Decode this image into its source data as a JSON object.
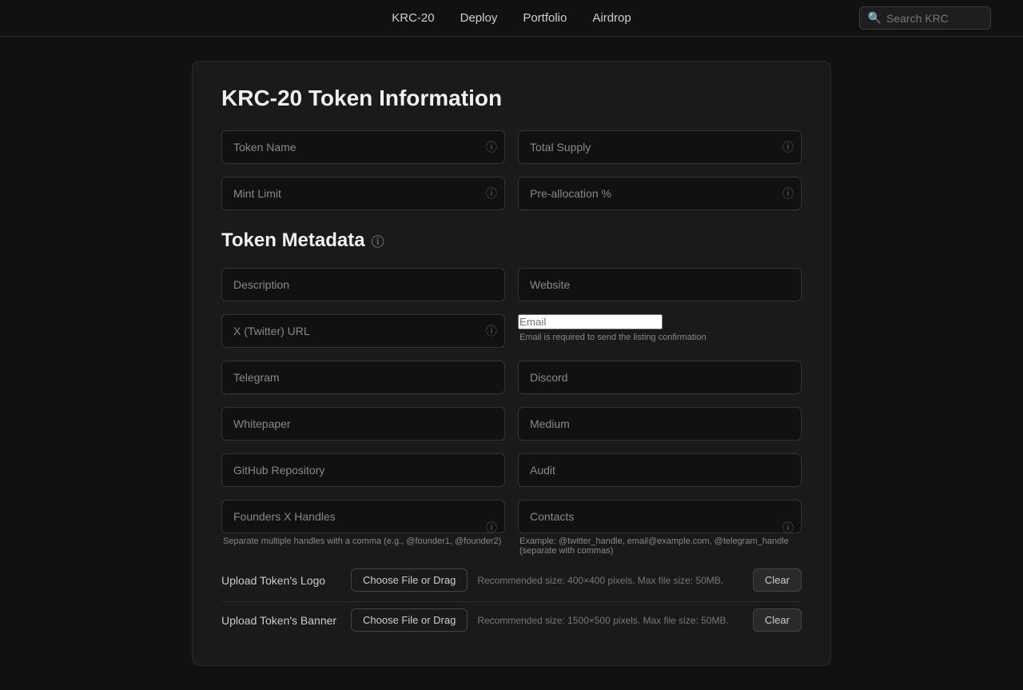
{
  "nav": {
    "links": [
      {
        "label": "KRC-20",
        "href": "#"
      },
      {
        "label": "Deploy",
        "href": "#"
      },
      {
        "label": "Portfolio",
        "href": "#"
      },
      {
        "label": "Airdrop",
        "href": "#"
      }
    ],
    "search_placeholder": "Search KRC"
  },
  "form": {
    "title": "KRC-20 Token Information",
    "fields": {
      "token_name_placeholder": "Token Name",
      "total_supply_placeholder": "Total Supply",
      "mint_limit_placeholder": "Mint Limit",
      "preallocation_placeholder": "Pre-allocation %",
      "description_placeholder": "Description",
      "website_placeholder": "Website",
      "x_twitter_placeholder": "X (Twitter) URL",
      "email_placeholder": "Email",
      "email_note": "Email is required to send the listing confirmation",
      "telegram_placeholder": "Telegram",
      "discord_placeholder": "Discord",
      "whitepaper_placeholder": "Whitepaper",
      "medium_placeholder": "Medium",
      "github_placeholder": "GitHub Repository",
      "audit_placeholder": "Audit",
      "founders_placeholder": "Founders X Handles",
      "founders_note": "Separate multiple handles with a comma (e.g., @founder1, @founder2)",
      "contacts_placeholder": "Contacts",
      "contacts_note": "Example: @twitter_handle, email@example.com, @telegram_handle (separate with commas)"
    },
    "metadata_heading": "Token Metadata",
    "upload_logo_label": "Upload Token's Logo",
    "upload_logo_btn": "Choose File or Drag",
    "upload_logo_hint": "Recommended size: 400×400 pixels. Max file size: 50MB.",
    "upload_logo_clear": "Clear",
    "upload_banner_label": "Upload Token's Banner",
    "upload_banner_btn": "Choose File or Drag",
    "upload_banner_hint": "Recommended size: 1500×500 pixels. Max file size: 50MB.",
    "upload_banner_clear": "Clear"
  }
}
